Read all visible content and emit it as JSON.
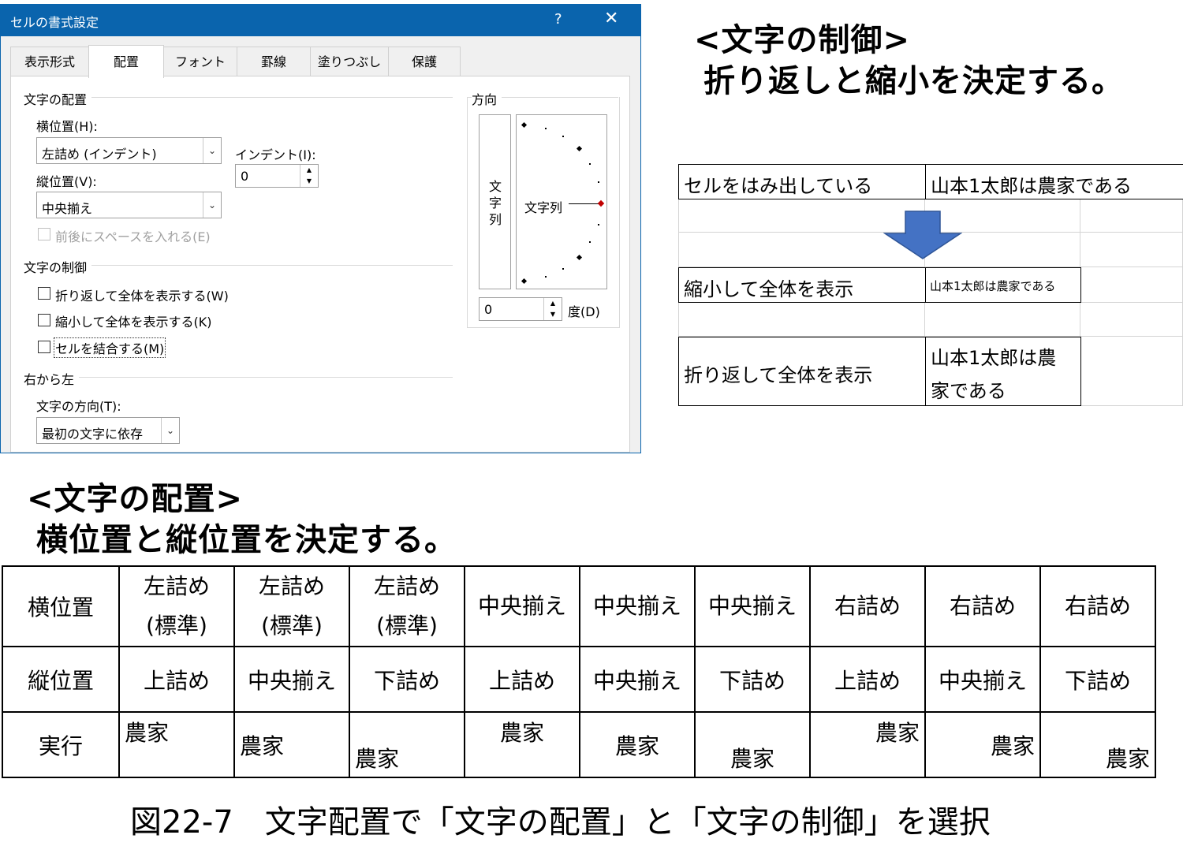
{
  "dialog": {
    "title": "セルの書式設定",
    "help": "?",
    "close": "✕",
    "tabs": [
      "表示形式",
      "配置",
      "フォント",
      "罫線",
      "塗りつぶし",
      "保護"
    ],
    "active_tab": "配置",
    "text_alignment": {
      "group": "文字の配置",
      "horizontal_label": "横位置(H):",
      "horizontal_value": "左詰め (インデント)",
      "vertical_label": "縦位置(V):",
      "vertical_value": "中央揃え",
      "indent_label": "インデント(I):",
      "indent_value": "0",
      "distributed_label": "前後にスペースを入れる(E)"
    },
    "text_control": {
      "group": "文字の制御",
      "wrap_label": "折り返して全体を表示する(W)",
      "shrink_label": "縮小して全体を表示する(K)",
      "merge_label": "セルを結合する(M)",
      "wrap_checked": false,
      "shrink_checked": false,
      "merge_checked": false
    },
    "rtl": {
      "group": "右から左",
      "direction_label": "文字の方向(T):",
      "direction_value": "最初の文字に依存"
    },
    "orientation": {
      "group": "方向",
      "vertical_text": "文字列",
      "horizontal_text": "文字列",
      "degrees_value": "0",
      "degrees_label": "度(D)"
    }
  },
  "heading_control": {
    "line1": "<文字の制御>",
    "line2": "折り返しと縮小を決定する。"
  },
  "heading_alignment": {
    "line1": "<文字の配置>",
    "line2": "横位置と縦位置を決定する。"
  },
  "sheet": {
    "row1_label": "セルをはみ出している",
    "row1_value": "山本1太郎は農家である",
    "row2_label": "縮小して全体を表示",
    "row2_value": "山本1太郎は農家である",
    "row3_label": "折り返して全体を表示",
    "row3_value_line1": "山本1太郎は農",
    "row3_value_line2": "家である"
  },
  "alignment_table": {
    "h_header": "横位置",
    "v_header": "縦位置",
    "result_header": "実行",
    "h_values": [
      "左詰め\n(標準)",
      "左詰め\n(標準)",
      "左詰め\n(標準)",
      "中央揃え",
      "中央揃え",
      "中央揃え",
      "右詰め",
      "右詰め",
      "右詰め"
    ],
    "v_values": [
      "上詰め",
      "中央揃え",
      "下詰め",
      "上詰め",
      "中央揃え",
      "下詰め",
      "上詰め",
      "中央揃え",
      "下詰め"
    ],
    "sample": "農家"
  },
  "caption": "図22-7　文字配置で「文字の配置」と「文字の制御」を選択",
  "colors": {
    "titlebar": "#0a64ad",
    "arrow": "#4472c4",
    "orientation_marker": "#c00000"
  }
}
